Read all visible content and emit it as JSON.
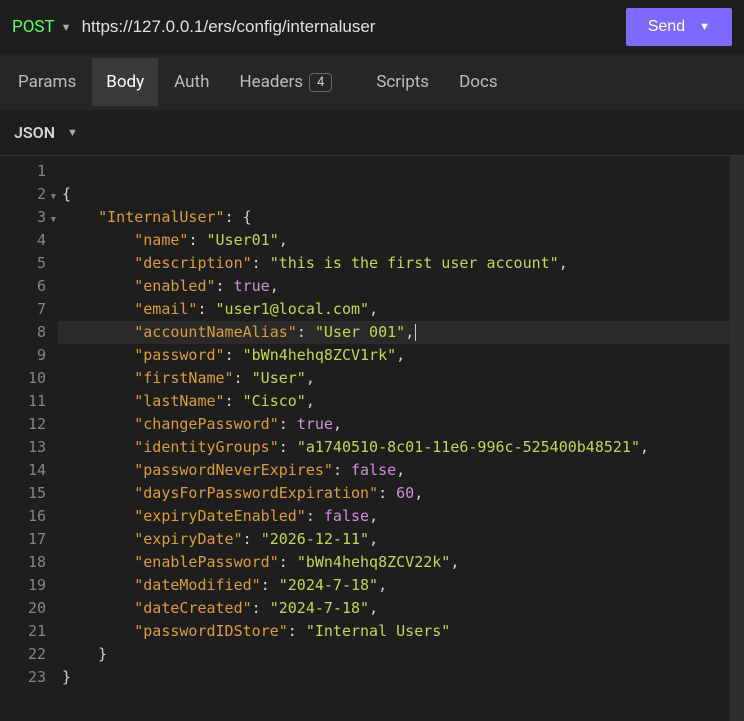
{
  "topbar": {
    "method": "POST",
    "url": "https://127.0.0.1/ers/config/internaluser",
    "send_label": "Send"
  },
  "tabs": {
    "params": "Params",
    "body": "Body",
    "auth": "Auth",
    "headers": "Headers",
    "headers_count": "4",
    "scripts": "Scripts",
    "docs": "Docs"
  },
  "toolbar": {
    "body_type": "JSON"
  },
  "editor": {
    "root_key": "InternalUser",
    "fields": {
      "name": "User01",
      "description": "this is the first user account",
      "enabled": true,
      "email": "user1@local.com",
      "accountNameAlias": "User 001",
      "password": "bWn4hehq8ZCV1rk",
      "firstName": "User",
      "lastName": "Cisco",
      "changePassword": true,
      "identityGroups": "a1740510-8c01-11e6-996c-525400b48521",
      "passwordNeverExpires": false,
      "daysForPasswordExpiration": 60,
      "expiryDateEnabled": false,
      "expiryDate": "2026-12-11",
      "enablePassword": "bWn4hehq8ZCV22k",
      "dateModified": "2024-7-18",
      "dateCreated": "2024-7-18",
      "passwordIDStore": "Internal Users"
    },
    "highlighted_line": 8,
    "line_count": 23
  }
}
